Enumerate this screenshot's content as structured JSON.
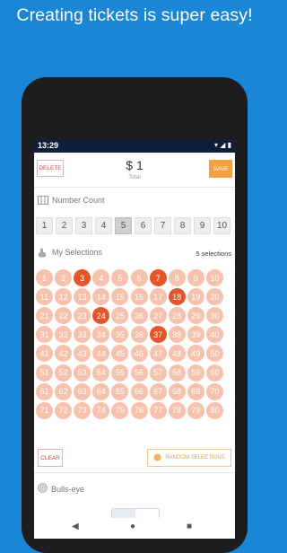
{
  "headline": "Creating tickets is super easy!",
  "status": {
    "time": "13:29"
  },
  "topbar": {
    "delete_label": "DELETE",
    "price": "$ 1",
    "total_label": "Total",
    "save_label": "SAVE"
  },
  "number_count": {
    "title": "Number Count",
    "options": [
      "1",
      "2",
      "3",
      "4",
      "5",
      "6",
      "7",
      "8",
      "9",
      "10"
    ],
    "selected": "5"
  },
  "selections": {
    "title": "My Selections",
    "count_text": "5 selections",
    "numbers": [
      "1",
      "2",
      "3",
      "4",
      "5",
      "6",
      "7",
      "8",
      "9",
      "10",
      "11",
      "12",
      "13",
      "14",
      "15",
      "16",
      "17",
      "18",
      "19",
      "20",
      "21",
      "22",
      "23",
      "24",
      "25",
      "26",
      "27",
      "28",
      "29",
      "30",
      "31",
      "32",
      "33",
      "34",
      "35",
      "36",
      "37",
      "38",
      "39",
      "40",
      "41",
      "42",
      "43",
      "44",
      "45",
      "46",
      "47",
      "48",
      "49",
      "50",
      "51",
      "52",
      "53",
      "54",
      "55",
      "56",
      "57",
      "58",
      "59",
      "60",
      "61",
      "62",
      "63",
      "64",
      "65",
      "66",
      "67",
      "68",
      "69",
      "70",
      "71",
      "72",
      "73",
      "74",
      "75",
      "76",
      "77",
      "78",
      "79",
      "80"
    ],
    "selected": [
      "3",
      "7",
      "18",
      "24",
      "37"
    ]
  },
  "actions": {
    "clear_label": "CLEAR",
    "random_label": "RANDOM SELECTIONS"
  },
  "bullseye": {
    "title": "Bulls-eye"
  },
  "colors": {
    "primary_bg": "#1a86d6",
    "accent": "#e4562a",
    "ball": "#f7c2ad",
    "save": "#f5a040",
    "delete": "#c84a4a"
  },
  "icons": [
    "number-count-icon",
    "touch-icon",
    "bullseye-icon",
    "dice-icon",
    "wifi-icon",
    "signal-icon",
    "battery-icon",
    "back-icon",
    "home-icon",
    "recents-icon"
  ]
}
